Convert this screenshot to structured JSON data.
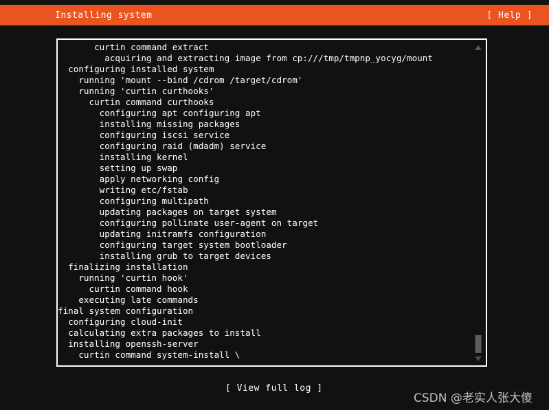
{
  "colors": {
    "accent": "#e95420",
    "background": "#111110",
    "text": "#ffffff",
    "scrollbar_thumb": "#5c5c5a",
    "watermark": "#cfcfcf"
  },
  "header": {
    "title": "Installing system",
    "help_label": "[ Help ]"
  },
  "log": {
    "lines": [
      "       curtin command extract",
      "         acquiring and extracting image from cp:///tmp/tmpnp_yocyg/mount",
      "  configuring installed system",
      "    running 'mount --bind /cdrom /target/cdrom'",
      "    running 'curtin curthooks'",
      "      curtin command curthooks",
      "        configuring apt configuring apt",
      "        installing missing packages",
      "        configuring iscsi service",
      "        configuring raid (mdadm) service",
      "        installing kernel",
      "        setting up swap",
      "        apply networking config",
      "        writing etc/fstab",
      "        configuring multipath",
      "        updating packages on target system",
      "        configuring pollinate user-agent on target",
      "        updating initramfs configuration",
      "        configuring target system bootloader",
      "        installing grub to target devices",
      "  finalizing installation",
      "    running 'curtin hook'",
      "      curtin command hook",
      "    executing late commands",
      "final system configuration",
      "  configuring cloud-init",
      "  calculating extra packages to install",
      "  installing openssh-server",
      "    curtin command system-install \\"
    ]
  },
  "scrollbar": {
    "up_arrow": "scroll-up-arrow",
    "down_arrow": "scroll-down-arrow",
    "thumb": "scroll-thumb"
  },
  "footer": {
    "view_full_log_label": "[ View full log ]"
  },
  "watermark": {
    "text": "CSDN @老实人张大傻"
  }
}
